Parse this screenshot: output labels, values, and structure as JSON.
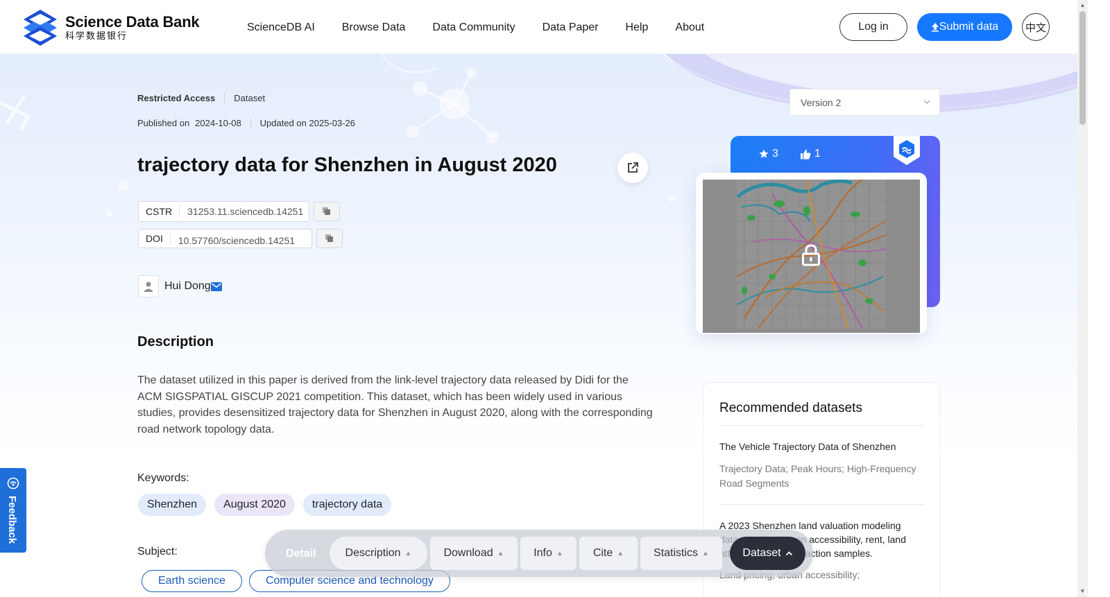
{
  "header": {
    "logo_en": "Science Data Bank",
    "logo_zh": "科学数据银行",
    "nav": [
      "ScienceDB AI",
      "Browse Data",
      "Data Community",
      "Data Paper",
      "Help",
      "About"
    ],
    "login": "Log in",
    "submit": "Submit data",
    "lang": "中文"
  },
  "meta": {
    "access": "Restricted Access",
    "type": "Dataset",
    "published_label": "Published on",
    "published": "2024-10-08",
    "updated": "Updated on 2025-03-26"
  },
  "title": "trajectory data for Shenzhen in August 2020",
  "ids": {
    "cstr_label": "CSTR",
    "cstr": "31253.11.sciencedb.14251",
    "doi_label": "DOI",
    "doi": "10.57760/sciencedb.14251"
  },
  "author": "Hui Dong",
  "description": {
    "title": "Description",
    "text": "The dataset utilized in this paper is derived from the link-level trajectory data released by Didi for the ACM SIGSPATIAL GISCUP 2021 competition. This dataset, which has been widely used in various studies, provides desensitized trajectory data for Shenzhen in August 2020, along with the corresponding road network topology data."
  },
  "keywords": {
    "label": "Keywords:",
    "items": [
      {
        "text": "Shenzhen",
        "color": "#e1ebfa"
      },
      {
        "text": "August 2020",
        "color": "#ebe5f7"
      },
      {
        "text": "trajectory data",
        "color": "#e1ebfa"
      }
    ]
  },
  "subject": {
    "label": "Subject:",
    "items": [
      "Earth science",
      "Computer science and technology"
    ]
  },
  "sidebar": {
    "version": "Version 2",
    "stars": "3",
    "likes": "1"
  },
  "recommended": {
    "title": "Recommended datasets",
    "items": [
      {
        "title": "The Vehicle Trajectory Data of Shenzhen",
        "tags": "Trajectory Data; Peak Hours; High-Frequency Road Segments"
      },
      {
        "title": "A 2023 Shenzhen land valuation modeling dataset with data on accessibility, rent, land attributes, and transaction samples.",
        "tags": "Land pricing; urban accessibility;"
      }
    ]
  },
  "feedback": "Feedback",
  "bottom_nav": {
    "detail": "Detail",
    "tabs": [
      "Description",
      "Download",
      "Info",
      "Cite",
      "Statistics"
    ],
    "active": "Dataset"
  },
  "colors": {
    "accent": "#1677ff",
    "subject_border": "#1e5bb8",
    "feedback": "#1f6fd9"
  }
}
